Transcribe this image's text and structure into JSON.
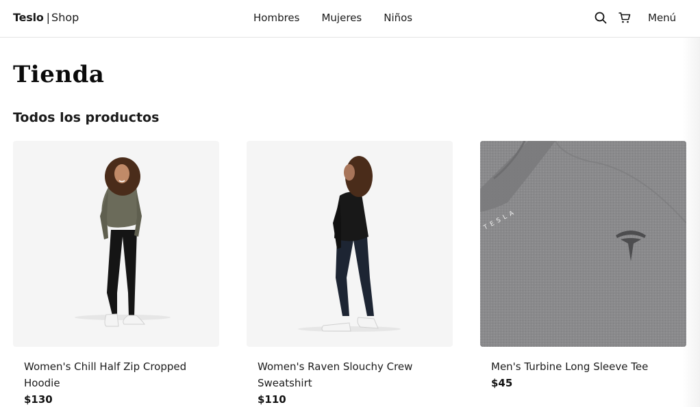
{
  "header": {
    "brand_bold": "Teslo",
    "brand_separator": "|",
    "brand_light": "Shop",
    "nav": [
      "Hombres",
      "Mujeres",
      "Niños"
    ],
    "menu_label": "Menú",
    "icons": [
      "search-icon",
      "cart-icon"
    ]
  },
  "page": {
    "title": "Tienda",
    "subtitle": "Todos los productos"
  },
  "products": [
    {
      "title": "Women's Chill Half Zip Cropped Hoodie",
      "price": "$130"
    },
    {
      "title": "Women's Raven Slouchy Crew Sweatshirt",
      "price": "$110"
    },
    {
      "title": "Men's Turbine Long Sleeve Tee",
      "price": "$45",
      "image_text": "TESLA"
    }
  ],
  "colors": {
    "text": "#1a1a1a",
    "image_background": "#f5f5f5",
    "tee_gray": "#8b8b8d",
    "divider": "#e4e4e4"
  }
}
